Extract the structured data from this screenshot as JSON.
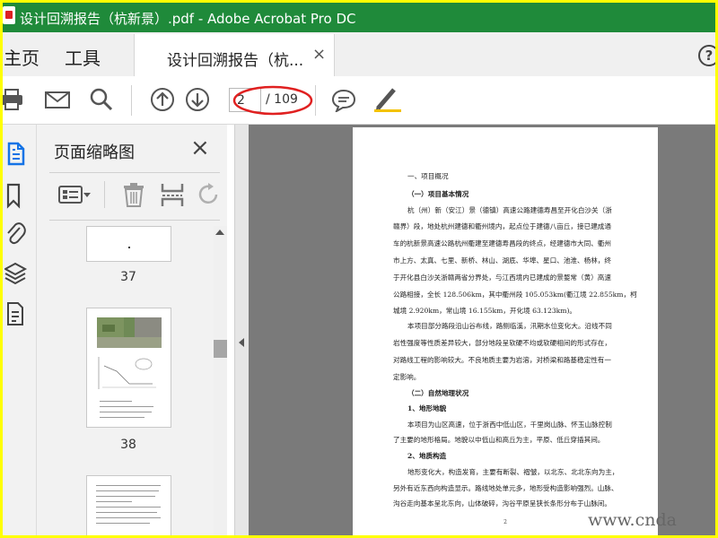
{
  "window": {
    "title": "设计回溯报告（杭新景）.pdf - Adobe Acrobat Pro DC"
  },
  "tabs": {
    "home": "主页",
    "tools": "工具",
    "document_tab": "设计回溯报告（杭...",
    "close_glyph": "×",
    "help_glyph": "?"
  },
  "toolbar": {
    "current_page": "2",
    "total_pages": "/ 109",
    "icons": [
      "print-icon",
      "email-icon",
      "search-icon",
      "previous-page-icon",
      "next-page-icon",
      "comment-icon",
      "highlight-pen-icon"
    ]
  },
  "rail": {
    "icons": [
      "page-thumbnails-icon",
      "bookmark-icon",
      "attachment-icon",
      "layers-icon",
      "document-properties-icon"
    ]
  },
  "thumbnails_panel": {
    "title": "页面缩略图",
    "close_glyph": "×",
    "tools": [
      "thumbnail-options-icon",
      "delete-icon",
      "crop-icon",
      "rotate-icon"
    ],
    "pages": [
      {
        "number": "37"
      },
      {
        "number": "38"
      }
    ]
  },
  "document": {
    "lines": [
      "一、项目概况",
      "（一）项目基本情况",
      "杭（州）新（安江）景（德镇）高速公路建德寿昌至开化白沙关（浙",
      "赣界）段，地处杭州建德和衢州境内，起点位于建德八亩丘，接已建成通",
      "车的杭新景高速公路杭州衢建至建德寿昌段的终点，经建德市大同、衢州",
      "市上方、太真、七里、新桥、林山、湖底、华埠、星口、池淮、杨林，终",
      "于开化县白沙关浙赣两省分界处，与江西境内已建成的景婺常（黄）高速",
      "公路相接，全长 128.506km，其中衢州段 105.053km(衢江境 22.855km，柯",
      "城境 2.920km，常山境 16.155km，开化境 63.123km)。",
      "本项目部分路段沿山谷布线，路侧临溪，汛期水位变化大。沿线不同",
      "岩性强度等性质差异较大，部分地段呈软硬不均或软硬相间的形式存在，",
      "对路线工程的影响较大。不良地质主要为岩溶，对桥梁和路基稳定性有一",
      "定影响。",
      "（二）自然地理状况",
      "1、地形地貌",
      "本项目为山区高速，位于浙西中低山区，千里岗山脉、怀玉山脉控制",
      "了主要的地形格局。地貌以中低山和高丘为主，平原、低丘穿插其间。",
      "2、地质构造",
      "地形变化大，构造发育，主要有断裂、褶皱，以北东、北北东向为主，",
      "另外有近东西向构造显示。路线地处单元多，地形受构造影响强烈。山脉、",
      "沟谷走向基本呈北东向，山体破碎，沟谷平原呈狭长条形分布于山脉间。"
    ],
    "page_footer": "2"
  },
  "watermark": "www.cnda",
  "colors": {
    "title_bar": "#1f8a3a",
    "border": "#ffff00",
    "annotation": "#e02020"
  }
}
